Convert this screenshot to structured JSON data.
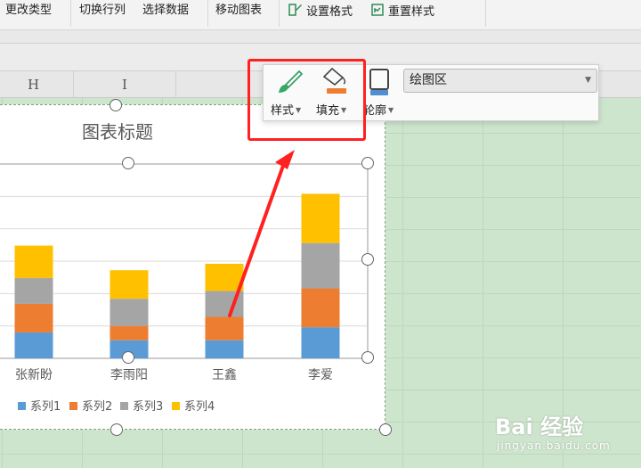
{
  "toolbar": {
    "change_type": "更改类型",
    "switch_rowcol": "切换行列",
    "select_data": "选择数据",
    "move_chart": "移动图表",
    "set_format": "设置格式",
    "reset_style": "重置样式"
  },
  "columns": {
    "h": "H",
    "i": "I"
  },
  "format_bar": {
    "style_label": "样式",
    "fill_label": "填充",
    "outline_label": "轮廓",
    "area_value": "绘图区",
    "fill_color": "#ed7d31",
    "outline_color": "#4f8ed0"
  },
  "colors": {
    "highlight": "#ff2020",
    "sheet_bg": "#cde4cd"
  },
  "chart_data": {
    "type": "bar",
    "stacked": true,
    "title": "图表标题",
    "categories": [
      "张新盼",
      "李雨阳",
      "王鑫",
      "李爱"
    ],
    "series": [
      {
        "name": "系列1",
        "color": "#5b9bd5",
        "values": [
          2.0,
          1.4,
          1.4,
          2.4
        ]
      },
      {
        "name": "系列2",
        "color": "#ed7d31",
        "values": [
          2.2,
          1.1,
          1.8,
          3.0
        ]
      },
      {
        "name": "系列3",
        "color": "#a5a5a5",
        "values": [
          2.0,
          2.1,
          2.0,
          3.5
        ]
      },
      {
        "name": "系列4",
        "color": "#ffc000",
        "values": [
          2.5,
          2.2,
          2.1,
          3.8
        ]
      }
    ],
    "ylim": [
      0,
      15
    ],
    "grid": true,
    "legend_position": "bottom"
  },
  "watermark": {
    "logo": "Bai 经验",
    "url": "jingyan.baidu.com"
  }
}
